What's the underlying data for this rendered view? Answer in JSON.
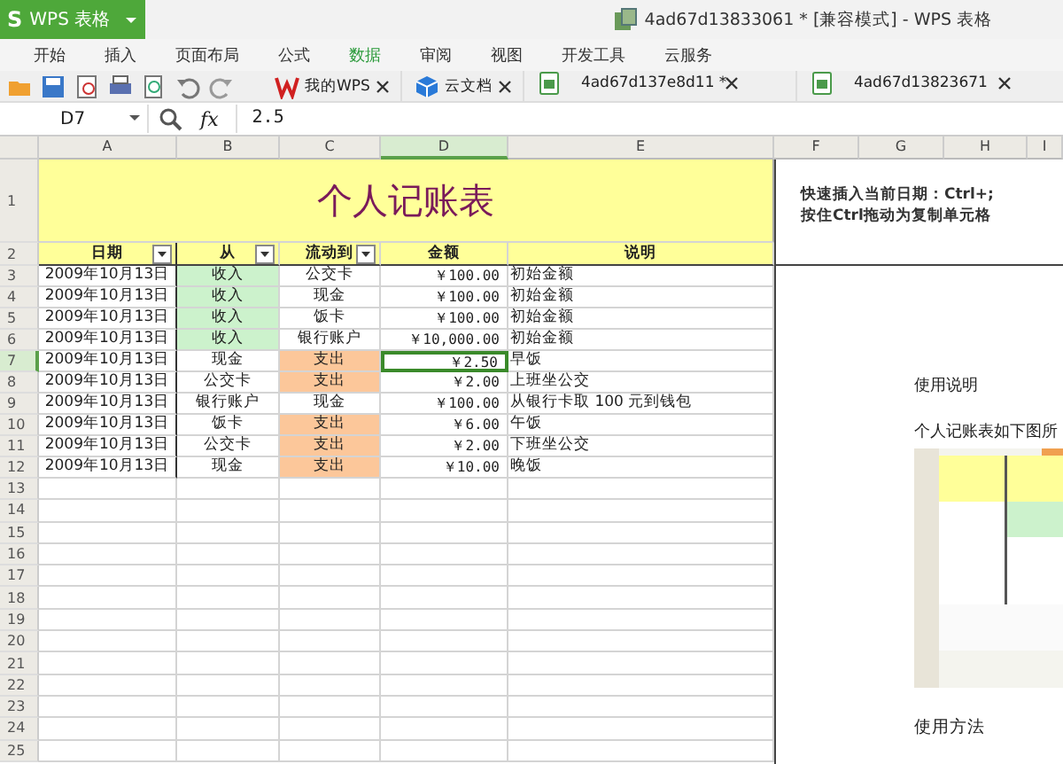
{
  "window": {
    "logo": "S",
    "app_button": "WPS 表格",
    "title": "4ad67d13833061 * [兼容模式] - WPS 表格"
  },
  "menu": [
    {
      "label": "开始",
      "selected": false
    },
    {
      "label": "插入",
      "selected": false
    },
    {
      "label": "页面布局",
      "selected": false
    },
    {
      "label": "公式",
      "selected": false
    },
    {
      "label": "数据",
      "selected": true
    },
    {
      "label": "审阅",
      "selected": false
    },
    {
      "label": "视图",
      "selected": false
    },
    {
      "label": "开发工具",
      "selected": false
    },
    {
      "label": "云服务",
      "selected": false
    }
  ],
  "doc_tabs": [
    {
      "label": "我的WPS",
      "kind": "wps"
    },
    {
      "label": "云文档",
      "kind": "cloud"
    },
    {
      "label": "4ad67d137e8d11 *",
      "kind": "sheet"
    },
    {
      "label": "4ad67d13823671",
      "kind": "sheet"
    }
  ],
  "formula_bar": {
    "cell": "D7",
    "fx": "fx",
    "value": "2.5"
  },
  "columns": [
    {
      "label": "A",
      "selected": false
    },
    {
      "label": "B",
      "selected": false
    },
    {
      "label": "C",
      "selected": false
    },
    {
      "label": "D",
      "selected": true
    },
    {
      "label": "E",
      "selected": false
    },
    {
      "label": "F",
      "selected": false
    },
    {
      "label": "G",
      "selected": false
    },
    {
      "label": "H",
      "selected": false
    },
    {
      "label": "I",
      "selected": false
    }
  ],
  "sheet": {
    "title": "个人记账表",
    "headers": [
      {
        "label": "日期",
        "filter": true
      },
      {
        "label": "从",
        "filter": true
      },
      {
        "label": "流动到",
        "filter": true
      },
      {
        "label": "金额",
        "filter": false
      },
      {
        "label": "说明",
        "filter": false
      }
    ],
    "rows": [
      {
        "date": "2009年10月13日",
        "from": "收入",
        "to": "公交卡",
        "amount": "￥100.00",
        "note": "初始金额",
        "kind": "income",
        "selected": false
      },
      {
        "date": "2009年10月13日",
        "from": "收入",
        "to": "现金",
        "amount": "￥100.00",
        "note": "初始金额",
        "kind": "income",
        "selected": false
      },
      {
        "date": "2009年10月13日",
        "from": "收入",
        "to": "饭卡",
        "amount": "￥100.00",
        "note": "初始金额",
        "kind": "income",
        "selected": false
      },
      {
        "date": "2009年10月13日",
        "from": "收入",
        "to": "银行账户",
        "amount": "￥10,000.00",
        "note": "初始金额",
        "kind": "income",
        "selected": false
      },
      {
        "date": "2009年10月13日",
        "from": "现金",
        "to": "支出",
        "amount": "￥2.50",
        "note": "早饭",
        "kind": "expense",
        "selected": true
      },
      {
        "date": "2009年10月13日",
        "from": "公交卡",
        "to": "支出",
        "amount": "￥2.00",
        "note": "上班坐公交",
        "kind": "expense",
        "selected": false
      },
      {
        "date": "2009年10月13日",
        "from": "银行账户",
        "to": "现金",
        "amount": "￥100.00",
        "note": "从银行卡取 100 元到钱包",
        "kind": "transfer",
        "selected": false
      },
      {
        "date": "2009年10月13日",
        "from": "饭卡",
        "to": "支出",
        "amount": "￥6.00",
        "note": "午饭",
        "kind": "expense",
        "selected": false
      },
      {
        "date": "2009年10月13日",
        "from": "公交卡",
        "to": "支出",
        "amount": "￥2.00",
        "note": "下班坐公交",
        "kind": "expense",
        "selected": false
      },
      {
        "date": "2009年10月13日",
        "from": "现金",
        "to": "支出",
        "amount": "￥10.00",
        "note": "晚饭",
        "kind": "expense",
        "selected": false
      }
    ],
    "row_numbers": [
      "1",
      "2",
      "3",
      "4",
      "5",
      "6",
      "7",
      "8",
      "9",
      "10",
      "11",
      "12",
      "13",
      "14",
      "15",
      "16",
      "17",
      "18",
      "19",
      "20",
      "21",
      "22",
      "23",
      "24",
      "25"
    ]
  },
  "tip_box": {
    "lines": [
      "快速插入当前日期：Ctrl+;",
      "按住Ctrl拖动为复制单元格"
    ]
  },
  "doc_panel": {
    "heading": "使用说明",
    "intro": "个人记账表如下图所",
    "subheading": "使用方法"
  }
}
